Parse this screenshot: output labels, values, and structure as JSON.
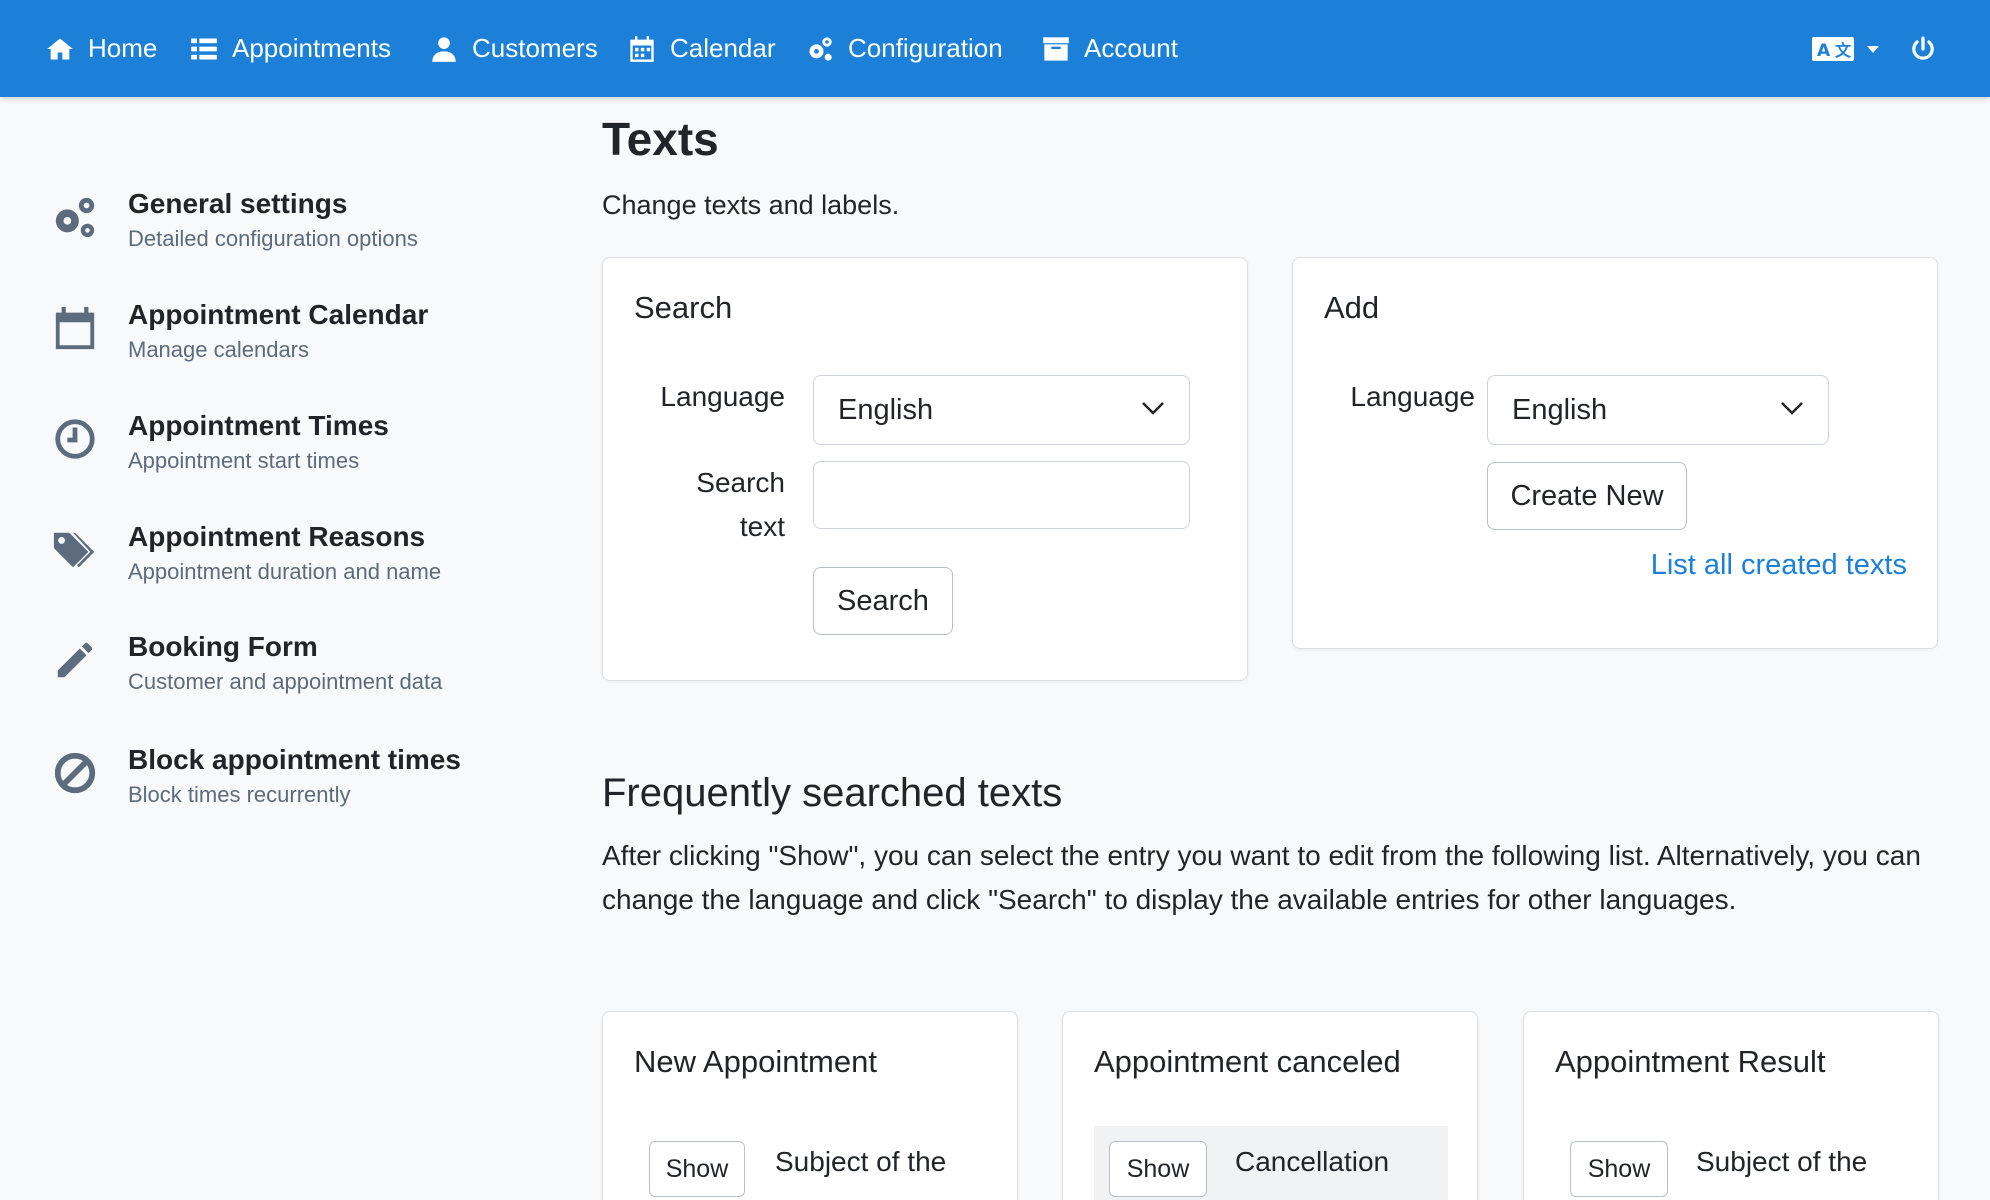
{
  "nav": {
    "items": [
      {
        "label": "Home",
        "icon": "home-icon"
      },
      {
        "label": "Appointments",
        "icon": "list-icon"
      },
      {
        "label": "Customers",
        "icon": "user-icon"
      },
      {
        "label": "Calendar",
        "icon": "calendar-icon"
      },
      {
        "label": "Configuration",
        "icon": "cogs-icon"
      },
      {
        "label": "Account",
        "icon": "archive-icon"
      }
    ],
    "language_icon": "language-icon",
    "power_icon": "power-icon"
  },
  "sidebar": {
    "items": [
      {
        "title": "General settings",
        "subtitle": "Detailed configuration options",
        "icon": "cogs-icon"
      },
      {
        "title": "Appointment Calendar",
        "subtitle": "Manage calendars",
        "icon": "calendar-icon"
      },
      {
        "title": "Appointment Times",
        "subtitle": "Appointment start times",
        "icon": "clock-icon"
      },
      {
        "title": "Appointment Reasons",
        "subtitle": "Appointment duration and name",
        "icon": "tags-icon"
      },
      {
        "title": "Booking Form",
        "subtitle": "Customer and appointment data",
        "icon": "pencil-icon"
      },
      {
        "title": "Block appointment times",
        "subtitle": "Block times recurrently",
        "icon": "ban-icon"
      }
    ]
  },
  "main": {
    "title": "Texts",
    "lead": "Change texts and labels.",
    "search_card": {
      "title": "Search",
      "language_label": "Language",
      "language_value": "English",
      "search_label": "Search text",
      "search_value": "",
      "search_button": "Search"
    },
    "add_card": {
      "title": "Add",
      "language_label": "Language",
      "language_value": "English",
      "create_button": "Create New",
      "list_link": "List all created texts"
    },
    "frequent": {
      "title": "Frequently searched texts",
      "description": "After clicking \"Show\", you can select the entry you want to edit from the following list. Alternatively, you can change the language and click \"Search\" to display the available entries for other languages.",
      "cards": [
        {
          "title": "New Appointment",
          "show": "Show",
          "entry": "Subject of the"
        },
        {
          "title": "Appointment canceled",
          "show": "Show",
          "entry": "Cancellation"
        },
        {
          "title": "Appointment Result",
          "show": "Show",
          "entry": "Subject of the"
        }
      ]
    }
  },
  "colors": {
    "primary": "#1c80d9",
    "background": "#f8f9fa",
    "muted": "#5c6b7e"
  }
}
